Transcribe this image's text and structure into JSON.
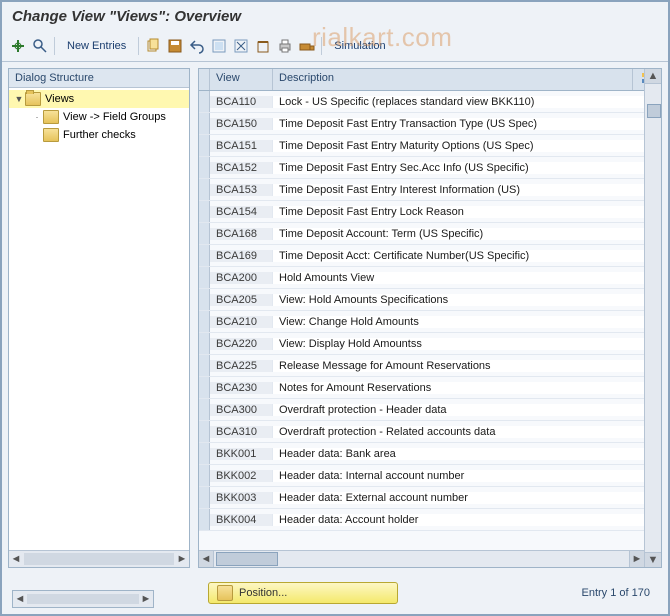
{
  "title": "Change View \"Views\": Overview",
  "watermark": "rialkart.com",
  "toolbar": {
    "new_entries": "New Entries",
    "simulation": "Simulation"
  },
  "tree": {
    "header": "Dialog Structure",
    "nodes": [
      {
        "label": "Views",
        "children": [
          {
            "label": "View -> Field Groups"
          },
          {
            "label": "Further checks"
          }
        ]
      }
    ]
  },
  "grid": {
    "headers": {
      "view": "View",
      "description": "Description"
    },
    "rows": [
      {
        "view": "BCA110",
        "desc": "Lock - US Specific (replaces standard view BKK110)"
      },
      {
        "view": "BCA150",
        "desc": "Time Deposit Fast Entry Transaction Type (US Spec)"
      },
      {
        "view": "BCA151",
        "desc": "Time Deposit Fast Entry Maturity Options (US Spec)"
      },
      {
        "view": "BCA152",
        "desc": "Time Deposit Fast Entry Sec.Acc Info (US Specific)"
      },
      {
        "view": "BCA153",
        "desc": "Time Deposit Fast Entry Interest Information (US)"
      },
      {
        "view": "BCA154",
        "desc": "Time Deposit Fast Entry Lock Reason"
      },
      {
        "view": "BCA168",
        "desc": "Time Deposit Account: Term (US Specific)"
      },
      {
        "view": "BCA169",
        "desc": "Time Deposit Acct: Certificate Number(US Specific)"
      },
      {
        "view": "BCA200",
        "desc": "Hold Amounts View"
      },
      {
        "view": "BCA205",
        "desc": "View: Hold Amounts Specifications"
      },
      {
        "view": "BCA210",
        "desc": "View: Change Hold Amounts"
      },
      {
        "view": "BCA220",
        "desc": "View: Display Hold Amountss"
      },
      {
        "view": "BCA225",
        "desc": "Release Message for Amount Reservations"
      },
      {
        "view": "BCA230",
        "desc": "Notes for Amount Reservations"
      },
      {
        "view": "BCA300",
        "desc": "Overdraft protection - Header data"
      },
      {
        "view": "BCA310",
        "desc": "Overdraft protection - Related accounts data"
      },
      {
        "view": "BKK001",
        "desc": "Header data: Bank area"
      },
      {
        "view": "BKK002",
        "desc": "Header data: Internal account number"
      },
      {
        "view": "BKK003",
        "desc": "Header data: External account number"
      },
      {
        "view": "BKK004",
        "desc": "Header data: Account holder"
      }
    ]
  },
  "footer": {
    "position_label": "Position...",
    "entry_count": "Entry 1 of 170"
  }
}
